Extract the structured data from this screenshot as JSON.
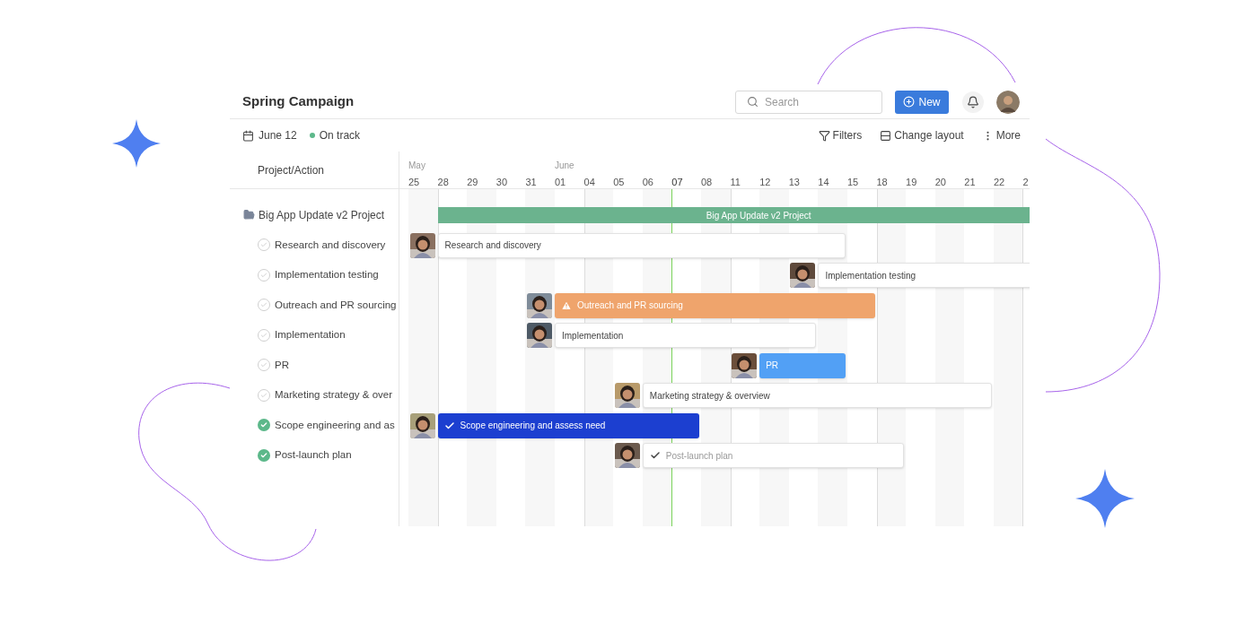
{
  "header": {
    "title": "Spring Campaign",
    "search": {
      "placeholder": "Search"
    },
    "new_button": "New"
  },
  "subheader": {
    "date": "June 12",
    "status": "On track",
    "actions": [
      {
        "kind": "filter",
        "label": "Filters"
      },
      {
        "kind": "layout",
        "label": "Change layout"
      },
      {
        "kind": "more",
        "label": "More"
      }
    ]
  },
  "list": {
    "heading": "Project/Action",
    "project": {
      "name": "Big App Update v2 Project",
      "children": [
        {
          "name": "Research and discovery",
          "checked": false
        },
        {
          "name": "Implementation testing",
          "checked": false
        },
        {
          "name": "Outreach and PR sourcing",
          "checked": false
        },
        {
          "name": "Implementation",
          "checked": false
        },
        {
          "name": "PR",
          "checked": false
        },
        {
          "name": "Marketing strategy & over",
          "checked": false
        },
        {
          "name": "Scope engineering and as",
          "checked": true
        },
        {
          "name": "Post-launch plan",
          "checked": true
        }
      ]
    }
  },
  "timeline": {
    "months": [
      {
        "label": "May"
      },
      {
        "label": "June"
      }
    ],
    "dates": [
      {
        "label": "25",
        "today": false
      },
      {
        "label": "28",
        "today": false
      },
      {
        "label": "29",
        "today": false
      },
      {
        "label": "30",
        "today": false
      },
      {
        "label": "31",
        "today": false
      },
      {
        "label": "01",
        "today": false
      },
      {
        "label": "04",
        "today": false
      },
      {
        "label": "05",
        "today": false
      },
      {
        "label": "06",
        "today": false
      },
      {
        "label": "07",
        "today": true
      },
      {
        "label": "08",
        "today": false
      },
      {
        "label": "11",
        "today": false
      },
      {
        "label": "12",
        "today": false
      },
      {
        "label": "13",
        "today": false
      },
      {
        "label": "14",
        "today": false
      },
      {
        "label": "15",
        "today": false
      },
      {
        "label": "18",
        "today": false
      },
      {
        "label": "19",
        "today": false
      },
      {
        "label": "20",
        "today": false
      },
      {
        "label": "21",
        "today": false
      },
      {
        "label": "22",
        "today": false
      },
      {
        "label": "2",
        "today": false
      }
    ],
    "bars": [
      {
        "kind": "summary",
        "label": "Big App Update v2 Project"
      },
      {
        "kind": "default",
        "label": "Research and discovery"
      },
      {
        "kind": "default",
        "label": "Implementation testing"
      },
      {
        "kind": "warning",
        "label": "Outreach and PR sourcing"
      },
      {
        "kind": "default",
        "label": "Implementation"
      },
      {
        "kind": "highlight",
        "label": "PR"
      },
      {
        "kind": "default",
        "label": "Marketing strategy & overview"
      },
      {
        "kind": "completed",
        "label": "Scope engineering and assess need"
      },
      {
        "kind": "completed_muted",
        "label": "Post-launch plan"
      }
    ]
  }
}
